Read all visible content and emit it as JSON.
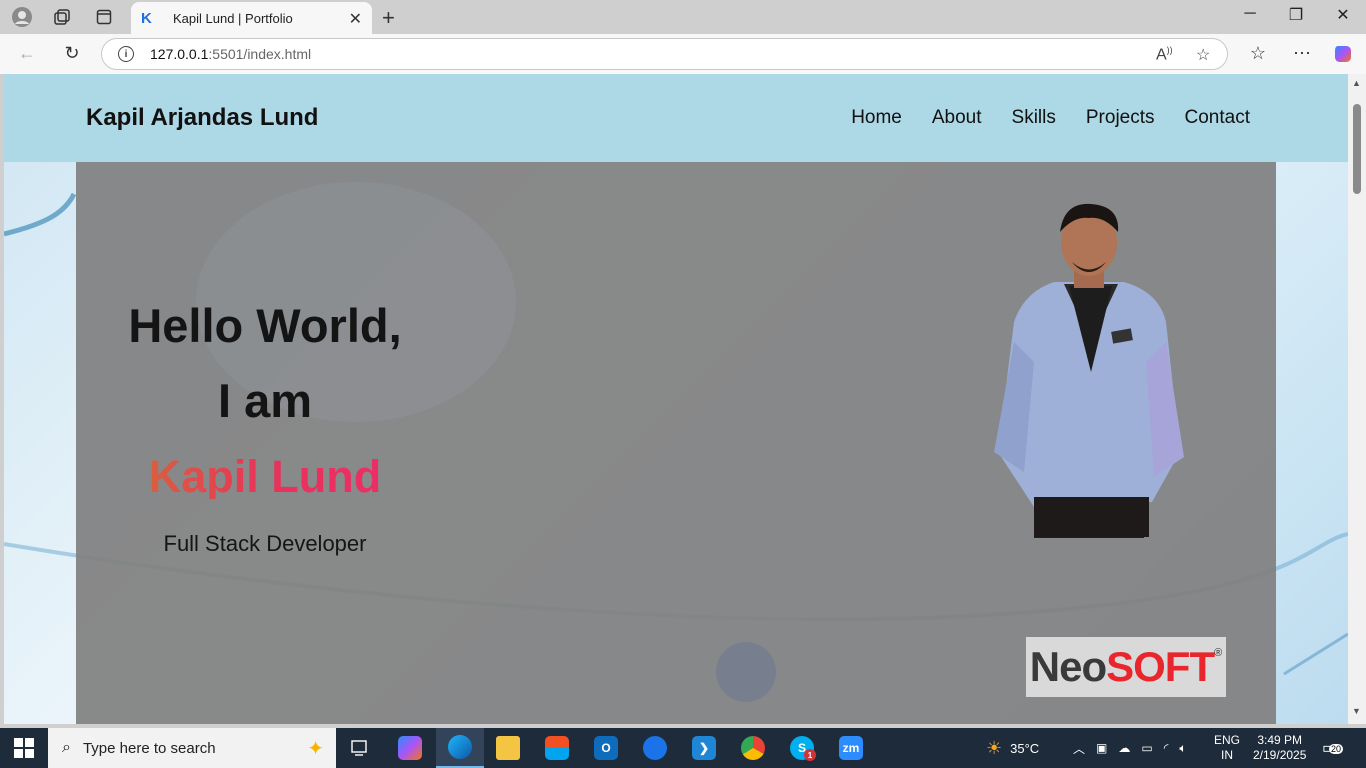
{
  "browser": {
    "tab_title": "Kapil Lund | Portfolio",
    "tab_favicon": "K",
    "url_host": "127.0.0.1",
    "url_rest": ":5501/index.html"
  },
  "site": {
    "brand": "Kapil Arjandas Lund",
    "menu": [
      "Home",
      "About",
      "Skills",
      "Projects",
      "Contact"
    ],
    "hero": {
      "line1": "Hello World,",
      "line2": "I am",
      "name": "Kapil Lund",
      "role": "Full Stack Developer"
    },
    "logo": {
      "part1": "Neo",
      "part2": "SOFT",
      "mark": "®"
    },
    "colors": {
      "header_bg": "#add8e6",
      "name_gradient_start": "#cf7a2e",
      "name_gradient_end": "#ef2a6f"
    }
  },
  "taskbar": {
    "search_placeholder": "Type here to search",
    "apps": [
      "copilot-icon",
      "edge-icon",
      "file-explorer-icon",
      "microsoft-store-icon",
      "outlook-icon",
      "browser-icon",
      "vscode-icon",
      "chrome-icon",
      "skype-icon",
      "zoom-icon"
    ],
    "zoom_label": "zm",
    "skype_badge": "1",
    "weather": "35°C",
    "language": "ENG",
    "region": "IN",
    "time": "3:49 PM",
    "date": "2/19/2025",
    "notifications": "20"
  }
}
